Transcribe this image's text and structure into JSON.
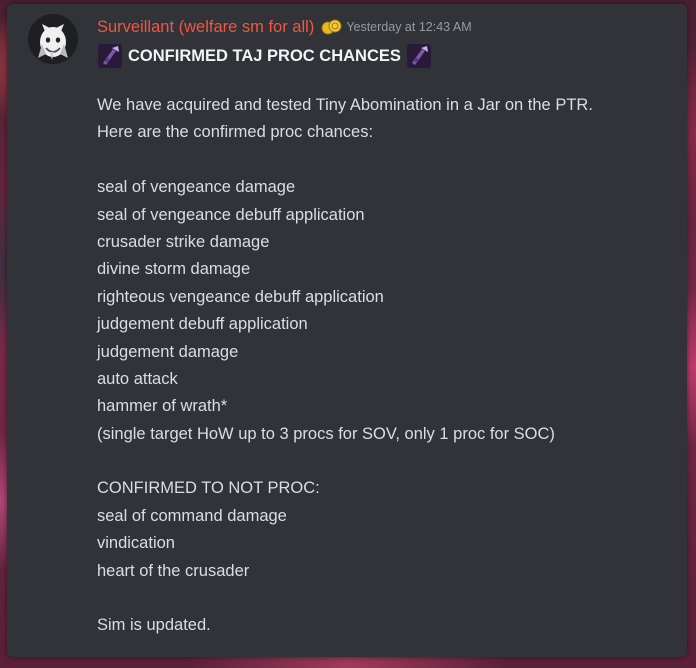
{
  "message": {
    "username": "Surveillant (welfare sm for all)",
    "timestamp": "Yesterday at 12:43 AM",
    "title": "CONFIRMED TAJ PROC CHANCES",
    "intro": [
      "We have acquired and tested Tiny Abomination in a Jar on the PTR.",
      "Here are the confirmed proc chances:"
    ],
    "procs": [
      "seal of vengeance damage",
      "seal of vengeance debuff application",
      "crusader strike damage",
      "divine storm damage",
      "righteous vengeance debuff  application",
      "judgement debuff application",
      "judgement damage",
      "auto attack",
      "hammer of wrath*",
      "(single target HoW up to 3 procs for SOV, only 1 proc for SOC)"
    ],
    "no_proc_heading": "CONFIRMED TO NOT PROC:",
    "no_procs": [
      "seal of command damage",
      "vindication",
      "heart of the crusader"
    ],
    "footer": "Sim is updated."
  },
  "colors": {
    "background": "#313338",
    "username": "#f2563f",
    "text": "#dbdee1",
    "timestamp": "#949ba4"
  },
  "icons": {
    "avatar": "goat-avatar-icon",
    "badge": "gold-coins-badge-icon",
    "title_emoji": "abomination-jar-icon"
  }
}
